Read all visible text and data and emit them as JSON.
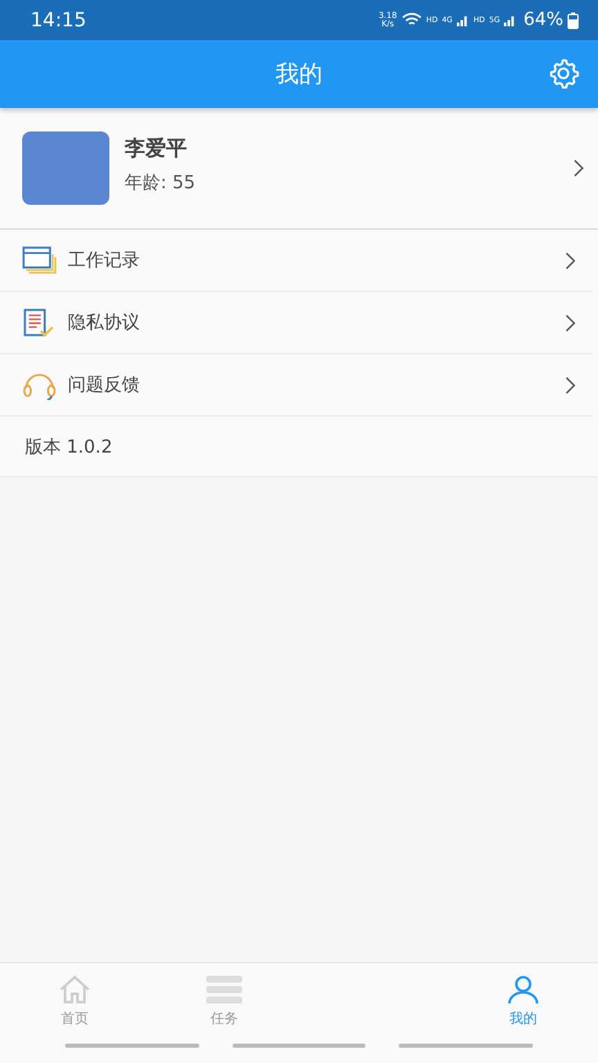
{
  "status_bar": {
    "time": "14:15",
    "speed_value": "3.18",
    "speed_unit": "K/s",
    "network_labels": [
      "HD",
      "4G",
      "HD",
      "5G"
    ],
    "battery": "64%"
  },
  "header": {
    "title": "我的"
  },
  "profile": {
    "name": "李爱平",
    "age": "年龄: 55"
  },
  "menu": [
    {
      "kind": "records",
      "label": "工作记录"
    },
    {
      "kind": "privacy",
      "label": "隐私协议"
    },
    {
      "kind": "feedback",
      "label": "问题反馈"
    }
  ],
  "version": "版本 1.0.2",
  "tabs": [
    {
      "kind": "home",
      "label": "首页",
      "selected": false
    },
    {
      "kind": "tasks",
      "label": "任务",
      "selected": false
    },
    {
      "kind": "me",
      "label": "我的",
      "selected": true
    }
  ]
}
